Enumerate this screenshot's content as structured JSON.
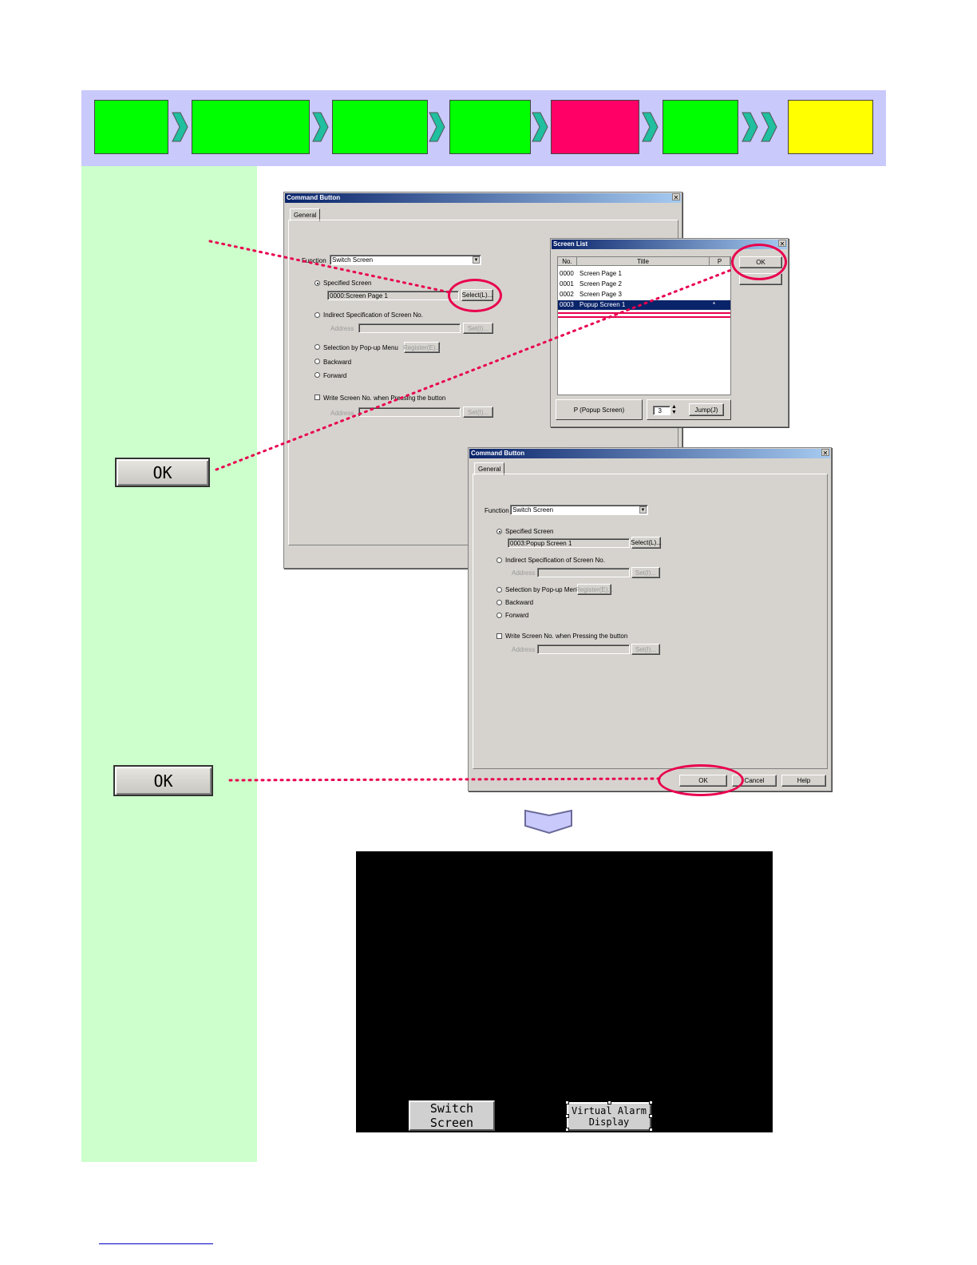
{
  "colors": {
    "step_bar_bg": "#c9c9fb",
    "step_green": "#00ff00",
    "step_active": "#ff0066",
    "step_final": "#ffff00",
    "chevron": "#1fbf9f",
    "side_panel": "#ccffcc",
    "highlight": "#e8004e",
    "selection": "#0a246a"
  },
  "step_bar": {
    "steps": [
      {
        "state": "done",
        "color": "#00ff00"
      },
      {
        "state": "done",
        "color": "#00ff00"
      },
      {
        "state": "done",
        "color": "#00ff00"
      },
      {
        "state": "done",
        "color": "#00ff00"
      },
      {
        "state": "current",
        "color": "#ff0066"
      },
      {
        "state": "todo",
        "color": "#00ff00"
      },
      {
        "state": "final",
        "color": "#ffff00"
      }
    ]
  },
  "side": {
    "ok1_label": "OK",
    "ok2_label": "OK"
  },
  "dialog1": {
    "title": "Command Button",
    "tab": "General",
    "function_label": "Function",
    "function_value": "Switch Screen",
    "opt_specified": "Specified Screen",
    "specified_value": "0000:Screen Page 1",
    "select_btn": "Select(L)...",
    "opt_indirect": "Indirect Specification of Screen No.",
    "address_label": "Address",
    "set_btn": "Set(I)...",
    "opt_popup": "Selection by Pop-up Menu",
    "register_btn": "Register(E)...",
    "opt_backward": "Backward",
    "opt_forward": "Forward",
    "write_chk": "Write Screen No. when Pressing the button",
    "address2_label": "Address",
    "set2_btn": "Set(I)..."
  },
  "screen_list": {
    "title": "Screen List",
    "columns": [
      "No.",
      "Title",
      "P"
    ],
    "rows": [
      {
        "no": "0000",
        "title": "Screen Page 1",
        "p": ""
      },
      {
        "no": "0001",
        "title": "Screen Page 2",
        "p": ""
      },
      {
        "no": "0002",
        "title": "Screen Page 3",
        "p": ""
      },
      {
        "no": "0003",
        "title": "Popup Screen 1",
        "p": "*"
      }
    ],
    "ok_btn": "OK",
    "popup_legend": "P (Popup Screen)",
    "jump_value": "3",
    "jump_btn": "Jump(J)"
  },
  "dialog2": {
    "title": "Command Button",
    "tab": "General",
    "function_label": "Function",
    "function_value": "Switch Screen",
    "opt_specified": "Specified Screen",
    "specified_value": "0003:Popup Screen 1",
    "select_btn": "Select(L)...",
    "opt_indirect": "Indirect Specification of Screen No.",
    "address_label": "Address",
    "set_btn": "Set(I)...",
    "opt_popup": "Selection by Pop-up Menu",
    "register_btn": "Register(E)...",
    "opt_backward": "Backward",
    "opt_forward": "Forward",
    "write_chk": "Write Screen No. when Pressing the button",
    "address2_label": "Address",
    "set2_btn": "Set(I)...",
    "ok_btn": "OK",
    "cancel_btn": "Cancel",
    "help_btn": "Help"
  },
  "screen_preview": {
    "btn_switch": "Switch Screen",
    "btn_alarm_line1": "Virtual Alarm",
    "btn_alarm_line2": "Display"
  }
}
